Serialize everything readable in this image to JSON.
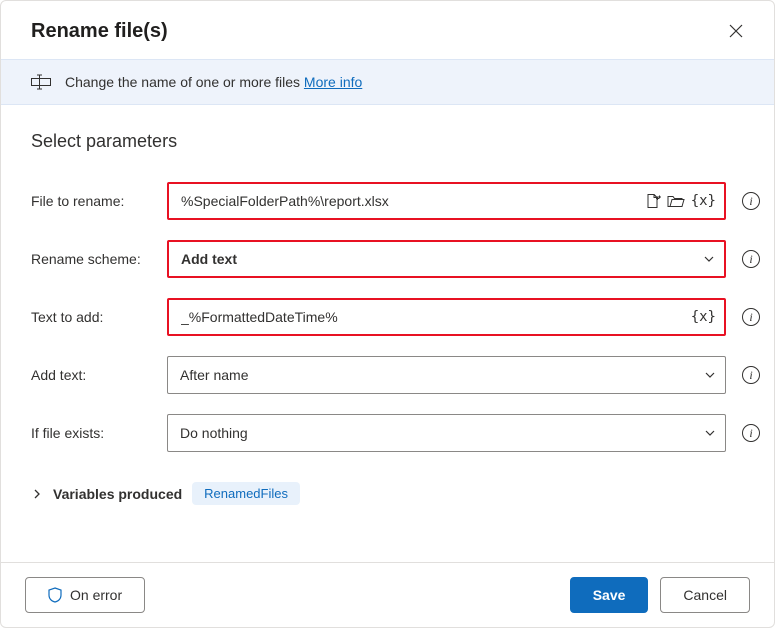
{
  "title": "Rename file(s)",
  "banner": {
    "text": "Change the name of one or more files ",
    "moreInfo": "More info"
  },
  "subhead": "Select parameters",
  "fields": {
    "fileToRename": {
      "label": "File to rename:",
      "value": "%SpecialFolderPath%\\report.xlsx"
    },
    "renameScheme": {
      "label": "Rename scheme:",
      "value": "Add text"
    },
    "textToAdd": {
      "label": "Text to add:",
      "value": "_%FormattedDateTime%"
    },
    "addText": {
      "label": "Add text:",
      "value": "After name"
    },
    "ifExists": {
      "label": "If file exists:",
      "value": "Do nothing"
    }
  },
  "variablesProduced": {
    "label": "Variables produced",
    "chip": "RenamedFiles"
  },
  "footer": {
    "onError": "On error",
    "save": "Save",
    "cancel": "Cancel"
  }
}
